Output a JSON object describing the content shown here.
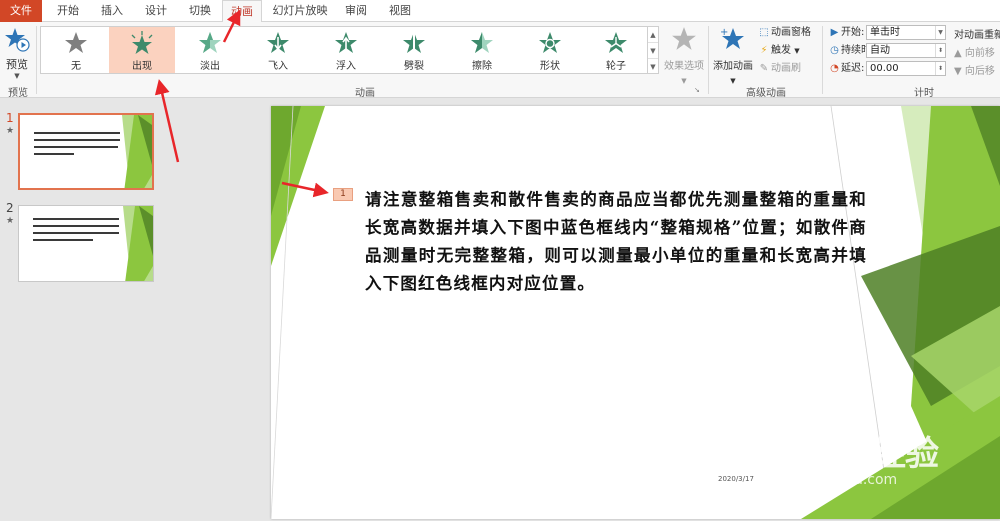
{
  "tabs": [
    {
      "label": "文件"
    },
    {
      "label": "开始"
    },
    {
      "label": "插入"
    },
    {
      "label": "设计"
    },
    {
      "label": "切换"
    },
    {
      "label": "动画"
    },
    {
      "label": "幻灯片放映"
    },
    {
      "label": "审阅"
    },
    {
      "label": "视图"
    }
  ],
  "ribbon": {
    "preview": {
      "label": "预览",
      "group_label": "预览",
      "icon": "star-play-icon"
    },
    "animation": {
      "group_label": "动画",
      "items": [
        {
          "label": "无",
          "icon": "star-gray-icon"
        },
        {
          "label": "出现",
          "icon": "star-burst-icon"
        },
        {
          "label": "淡出",
          "icon": "star-fade-icon"
        },
        {
          "label": "飞入",
          "icon": "star-flyin-icon"
        },
        {
          "label": "浮入",
          "icon": "star-float-icon"
        },
        {
          "label": "劈裂",
          "icon": "star-split-icon"
        },
        {
          "label": "擦除",
          "icon": "star-wipe-icon"
        },
        {
          "label": "形状",
          "icon": "star-shape-icon"
        },
        {
          "label": "轮子",
          "icon": "star-wheel-icon"
        }
      ],
      "effect_options": "效果选项"
    },
    "advanced": {
      "group_label": "高级动画",
      "add_animation": "添加动画",
      "pane": "动画窗格",
      "trigger": "触发",
      "painter": "动画刷"
    },
    "timing": {
      "group_label": "计时",
      "start_label": "开始:",
      "start_value": "单击时",
      "duration_label": "持续时间:",
      "duration_value": "自动",
      "delay_label": "延迟:",
      "delay_value": "00.00",
      "reorder_title": "对动画重新",
      "move_earlier": "向前移",
      "move_later": "向后移"
    }
  },
  "thumbnails": [
    {
      "number": "1",
      "star": "★"
    },
    {
      "number": "2",
      "star": "★"
    }
  ],
  "slide": {
    "anim_tag": "1",
    "text": "请注意整箱售卖和散件售卖的商品应当都优先测量整箱的重量和长宽高数据并填入下图中蓝色框线内“整箱规格”位置；如散件商品测量时无完整整箱，则可以测量最小单位的重量和长宽高并填入下图红色线框内对应位置。",
    "date": "2020/3/17"
  },
  "watermark": {
    "brand": "Baidu经验",
    "url": "jingyan.baidu.com"
  },
  "colors": {
    "accent": "#d24726",
    "selected": "#fbd2bf",
    "green": "#8cc63f",
    "arrow": "#e8262a"
  }
}
